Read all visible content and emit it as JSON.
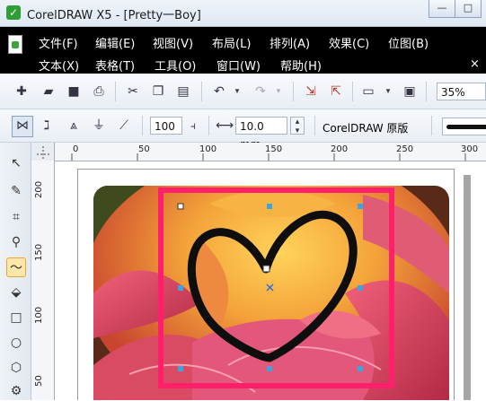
{
  "window": {
    "title": "CorelDRAW X5 - [Pretty一Boy]",
    "app_icon": "coreldraw-icon",
    "minimize_label": "—",
    "restore_label": "□"
  },
  "menu": {
    "row1": [
      "文件(F)",
      "编辑(E)",
      "视图(V)",
      "布局(L)",
      "排列(A)",
      "效果(C)",
      "位图(B)"
    ],
    "row2": [
      "文本(X)",
      "表格(T)",
      "工具(O)",
      "窗口(W)",
      "帮助(H)"
    ],
    "close_label": "×"
  },
  "toolbar": {
    "zoom_value": "35%"
  },
  "property_bar": {
    "smoothness_value": "100",
    "nib_width_value": "10.0 mm",
    "stroke_style_value": "CorelDRAW 原版"
  },
  "rulers": {
    "horizontal_labels": [
      "0",
      "50",
      "100",
      "150",
      "200",
      "250",
      "300"
    ],
    "vertical_labels": [
      "200",
      "150",
      "100",
      "50"
    ]
  },
  "colors": {
    "selection_frame": "#ff1f6b",
    "heart_stroke": "#0e0e0e",
    "photo_background": "#6b2a1a"
  }
}
